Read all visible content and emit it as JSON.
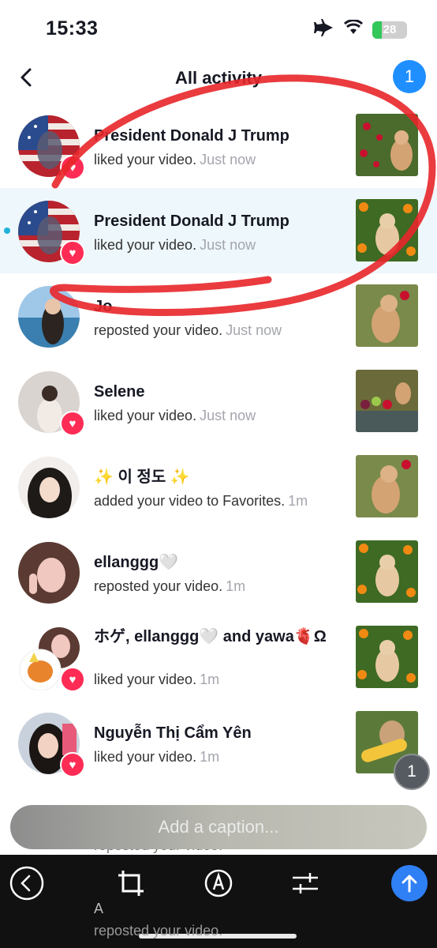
{
  "status_bar": {
    "time": "15:33",
    "battery": "28",
    "battery_level_percent": 28,
    "icons": [
      "airplane-icon",
      "wifi-icon",
      "battery-icon"
    ]
  },
  "header": {
    "title": "All activity",
    "notification_count": "1"
  },
  "activities": [
    {
      "name": "President Donald J Trump",
      "action": "liked your video.",
      "time": "Just now",
      "heart": true,
      "highlight": false
    },
    {
      "name": "President Donald J Trump",
      "action": "liked your video.",
      "time": "Just now",
      "heart": true,
      "highlight": true
    },
    {
      "name": "Jo",
      "action": "reposted your video.",
      "time": "Just now",
      "heart": false,
      "highlight": false
    },
    {
      "name": "Selene",
      "action": "liked your video.",
      "time": "Just now",
      "heart": true,
      "highlight": false
    },
    {
      "name": "✨ 이 정도 ✨",
      "action": "added your video to Favorites.",
      "time": "1m",
      "heart": false,
      "highlight": false
    },
    {
      "name": "ellanggg🤍",
      "action": "reposted your video.",
      "time": "1m",
      "heart": false,
      "highlight": false
    },
    {
      "name": "ホゲ, ellanggg🤍 and yawa🫀Ω",
      "action": "liked your video.",
      "time": "1m",
      "heart": true,
      "highlight": false
    },
    {
      "name": "Nguyễn Thị Cẩm Yên",
      "action": "liked your video.",
      "time": "1m",
      "heart": true,
      "highlight": false
    }
  ],
  "partial_rows": {
    "row9_action": "reposted your video.",
    "row10_name": "A",
    "row10_action": "reposted your video."
  },
  "floating_badge": "1",
  "caption": {
    "placeholder": "Add a caption..."
  },
  "toolbar": {
    "icons": [
      "back-circle-icon",
      "crop-icon",
      "markup-pen-icon",
      "adjust-icon",
      "send-arrow-icon"
    ]
  },
  "colors": {
    "accent_blue": "#1f8fff",
    "heart_pink": "#fe2c55",
    "unread_dot": "#20b2d8",
    "annotation_red": "#e8262a"
  }
}
